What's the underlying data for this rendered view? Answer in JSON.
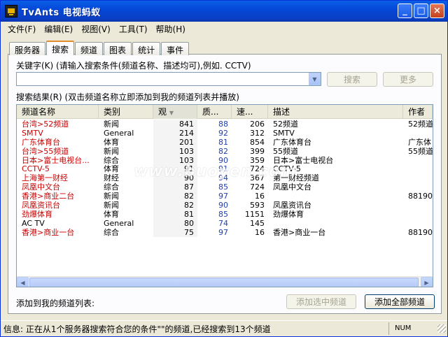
{
  "window": {
    "title": "TvAnts 电视蚂蚁"
  },
  "menu": [
    "文件(F)",
    "编辑(E)",
    "视图(V)",
    "工具(T)",
    "帮助(H)"
  ],
  "tabs": [
    "服务器",
    "搜索",
    "频道",
    "图表",
    "统计",
    "事件"
  ],
  "active_tab": 1,
  "search": {
    "keyword_label": "关键字(K) (请输入搜索条件(频道名称、描述均可),例如. CCTV)",
    "input_value": "",
    "search_button": "搜索",
    "more_button": "更多"
  },
  "results": {
    "label": "搜索结果(R) (双击频道名称立即添加到我的频道列表并播放)",
    "columns": [
      "频道名称",
      "类别",
      "观",
      "质...",
      "速...",
      "描述",
      "作者"
    ],
    "rows": [
      {
        "name": "台湾>52频道",
        "cat": "新闻",
        "a": "841",
        "b": "88",
        "c": "206",
        "desc": "52频道",
        "author": "52频道",
        "color": "#cc0000"
      },
      {
        "name": "SMTV",
        "cat": "General",
        "a": "214",
        "b": "92",
        "c": "312",
        "desc": "SMTV",
        "author": "",
        "color": "#cc0000"
      },
      {
        "name": "广东体育台",
        "cat": "体育",
        "a": "201",
        "b": "81",
        "c": "854",
        "desc": "广东体育台",
        "author": "广东体",
        "color": "#cc0000"
      },
      {
        "name": "台湾>55频道",
        "cat": "新闻",
        "a": "103",
        "b": "82",
        "c": "399",
        "desc": "55频道",
        "author": "55频道",
        "color": "#cc0000"
      },
      {
        "name": "日本>富士电视台...",
        "cat": "综合",
        "a": "103",
        "b": "90",
        "c": "359",
        "desc": "日本>富士电视台",
        "author": "",
        "color": "#cc0000"
      },
      {
        "name": "CCTV-5",
        "cat": "体育",
        "a": "91",
        "b": "91",
        "c": "724",
        "desc": "CCTV-5",
        "author": "",
        "color": "#cc0000"
      },
      {
        "name": "上海第一财经",
        "cat": "财经",
        "a": "90",
        "b": "94",
        "c": "367",
        "desc": "第一财经频道",
        "author": "",
        "color": "#cc0000"
      },
      {
        "name": "凤凰中文台",
        "cat": "综合",
        "a": "87",
        "b": "85",
        "c": "724",
        "desc": "凤凰中文台",
        "author": "",
        "color": "#cc0000"
      },
      {
        "name": "香港>商业二台",
        "cat": "新闻",
        "a": "82",
        "b": "97",
        "c": "16",
        "desc": "",
        "author": "881903",
        "color": "#cc0000"
      },
      {
        "name": "凤凰资讯台",
        "cat": "新闻",
        "a": "82",
        "b": "90",
        "c": "593",
        "desc": "凤凰资讯台",
        "author": "",
        "color": "#cc0000"
      },
      {
        "name": "劲爆体育",
        "cat": "体育",
        "a": "81",
        "b": "85",
        "c": "1151",
        "desc": "劲爆体育",
        "author": "",
        "color": "#cc0000"
      },
      {
        "name": "AC TV",
        "cat": "General",
        "a": "80",
        "b": "74",
        "c": "145",
        "desc": "",
        "author": "",
        "color": "#000000"
      },
      {
        "name": "香港>商业一台",
        "cat": "综合",
        "a": "75",
        "b": "97",
        "c": "16",
        "desc": "香港>商业一台",
        "author": "881903",
        "color": "#cc0000"
      }
    ]
  },
  "bottom": {
    "add_label": "添加到我的频道列表:",
    "add_selected_button": "添加选中频道",
    "add_all_button": "添加全部频道"
  },
  "status": {
    "text": "信息: 正在从1个服务器搜索符合您的条件\"\"的频道,已经搜索到13个频道",
    "num": "NUM"
  },
  "watermark": "www.buoyen.com"
}
